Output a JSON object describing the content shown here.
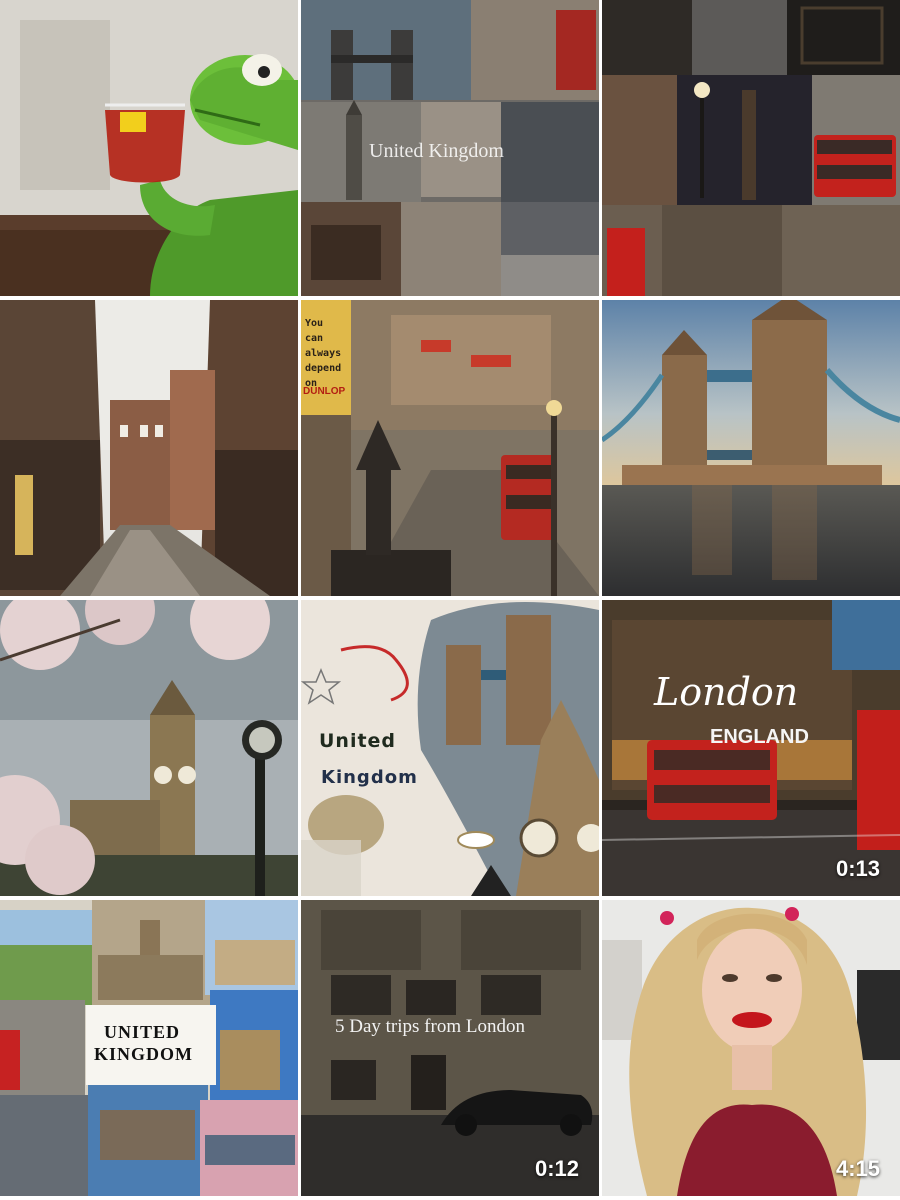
{
  "grid": {
    "tiles": [
      {
        "id": "kermit-tea",
        "type": "photo"
      },
      {
        "id": "uk-collage-1",
        "type": "photo",
        "overlay_text": "United Kingdom"
      },
      {
        "id": "london-night-collage",
        "type": "photo"
      },
      {
        "id": "old-street",
        "type": "photo"
      },
      {
        "id": "piccadilly-vintage",
        "type": "photo",
        "sign_text": "You can always depend on",
        "brand_text": "DUNLOP"
      },
      {
        "id": "tower-bridge-sunset",
        "type": "photo"
      },
      {
        "id": "big-ben-blossoms",
        "type": "photo"
      },
      {
        "id": "uk-scrapbook",
        "type": "photo",
        "title_line1": "United",
        "title_line2": "Kingdom"
      },
      {
        "id": "london-england-video",
        "type": "video",
        "title_script": "London",
        "subtitle": "ENGLAND",
        "duration": "0:13"
      },
      {
        "id": "uk-postcards",
        "type": "photo",
        "title_line1": "UNITED",
        "title_line2": "KINGDOM"
      },
      {
        "id": "day-trips-video",
        "type": "video",
        "title": "5 Day trips from London",
        "duration": "0:12"
      },
      {
        "id": "woman-video",
        "type": "video",
        "duration": "4:15"
      }
    ]
  }
}
